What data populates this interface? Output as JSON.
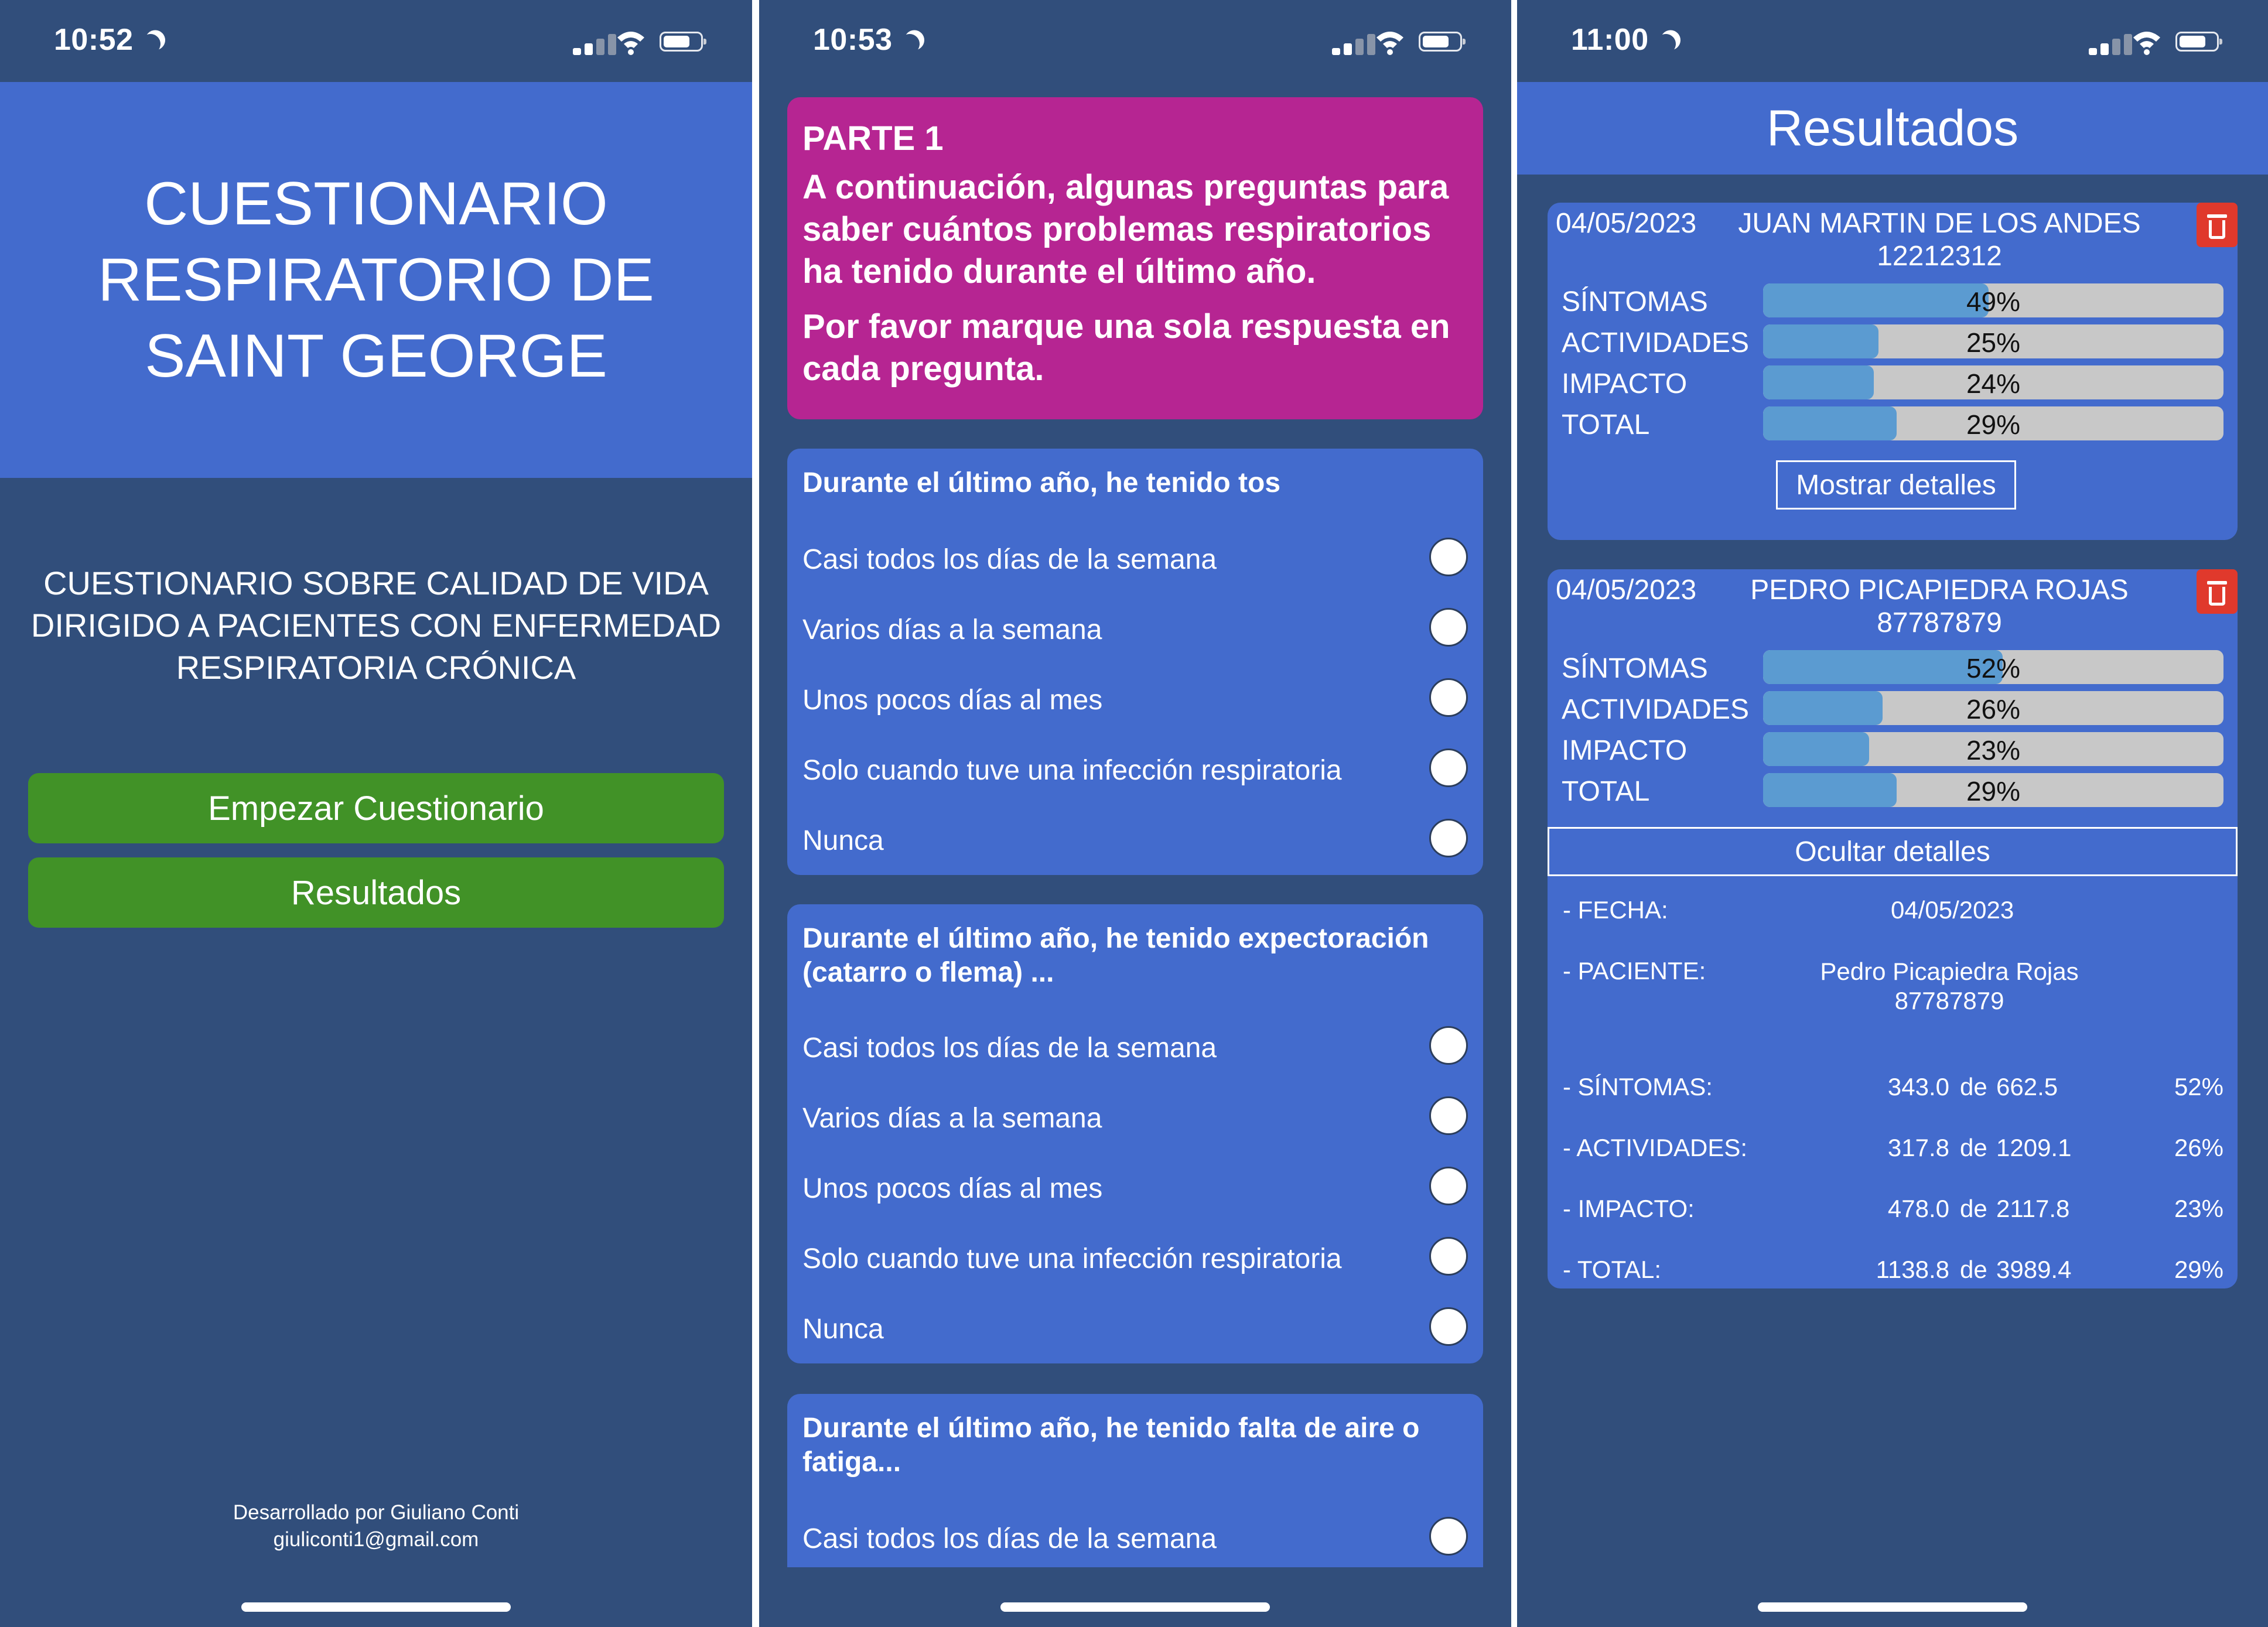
{
  "colors": {
    "background": "#314e7b",
    "header_blue": "#436bcd",
    "green_button": "#419227",
    "magenta": "#b62592",
    "bar_fill": "#5b9bd1",
    "bar_track": "#c8c8c8",
    "delete_red": "#e0392c"
  },
  "screen1": {
    "time": "10:52",
    "title": "CUESTIONARIO RESPIRATORIO DE SAINT GEORGE",
    "subtitle": "CUESTIONARIO SOBRE CALIDAD DE VIDA DIRIGIDO A PACIENTES CON ENFERMEDAD RESPIRATORIA CRÓNICA",
    "start_button": "Empezar Cuestionario",
    "results_button": "Resultados",
    "footer_line1": "Desarrollado por Giuliano Conti",
    "footer_line2": "giuliconti1@gmail.com"
  },
  "screen2": {
    "time": "10:53",
    "intro": {
      "heading": "PARTE 1",
      "paragraph1": "A continuación, algunas preguntas para saber cuántos problemas respiratorios ha tenido durante el último año.",
      "paragraph2": "Por favor marque una sola respuesta en cada pregunta."
    },
    "questions": [
      {
        "title": "Durante el último año, he tenido tos",
        "options": [
          "Casi todos los días de la semana",
          "Varios días a la semana",
          "Unos pocos días al mes",
          "Solo cuando tuve una infección respiratoria",
          "Nunca"
        ]
      },
      {
        "title": "Durante el último año, he tenido expectoración (catarro o flema) ...",
        "options": [
          "Casi todos los días de la semana",
          "Varios días a la semana",
          "Unos pocos días al mes",
          "Solo cuando tuve una infección respiratoria",
          "Nunca"
        ]
      },
      {
        "title": "Durante el último año, he tenido falta de aire o fatiga...",
        "options": [
          "Casi todos los días de la semana"
        ]
      }
    ]
  },
  "screen3": {
    "time": "11:00",
    "header": "Resultados",
    "results": [
      {
        "date": "04/05/2023",
        "name": "JUAN MARTIN DE LOS ANDES",
        "id": "12212312",
        "bars": [
          {
            "label": "SÍNTOMAS",
            "value": 49,
            "text": "49%"
          },
          {
            "label": "ACTIVIDADES",
            "value": 25,
            "text": "25%"
          },
          {
            "label": "IMPACTO",
            "value": 24,
            "text": "24%"
          },
          {
            "label": "TOTAL",
            "value": 29,
            "text": "29%"
          }
        ],
        "toggle": "Mostrar detalles"
      },
      {
        "date": "04/05/2023",
        "name": "PEDRO PICAPIEDRA ROJAS",
        "id": "87787879",
        "bars": [
          {
            "label": "SÍNTOMAS",
            "value": 52,
            "text": "52%"
          },
          {
            "label": "ACTIVIDADES",
            "value": 26,
            "text": "26%"
          },
          {
            "label": "IMPACTO",
            "value": 23,
            "text": "23%"
          },
          {
            "label": "TOTAL",
            "value": 29,
            "text": "29%"
          }
        ],
        "toggle": "Ocultar detalles",
        "details": {
          "fecha_label": "- FECHA:",
          "fecha": "04/05/2023",
          "paciente_label": "- PACIENTE:",
          "paciente_name": "Pedro Picapiedra Rojas",
          "paciente_id": "87787879",
          "de": "de",
          "rows": [
            {
              "label": "- SÍNTOMAS:",
              "score": "343.0",
              "max": "662.5",
              "pct": "52%"
            },
            {
              "label": "- ACTIVIDADES:",
              "score": "317.8",
              "max": "1209.1",
              "pct": "26%"
            },
            {
              "label": "- IMPACTO:",
              "score": "478.0",
              "max": "2117.8",
              "pct": "23%"
            },
            {
              "label": "- TOTAL:",
              "score": "1138.8",
              "max": "3989.4",
              "pct": "29%"
            }
          ]
        }
      }
    ]
  }
}
